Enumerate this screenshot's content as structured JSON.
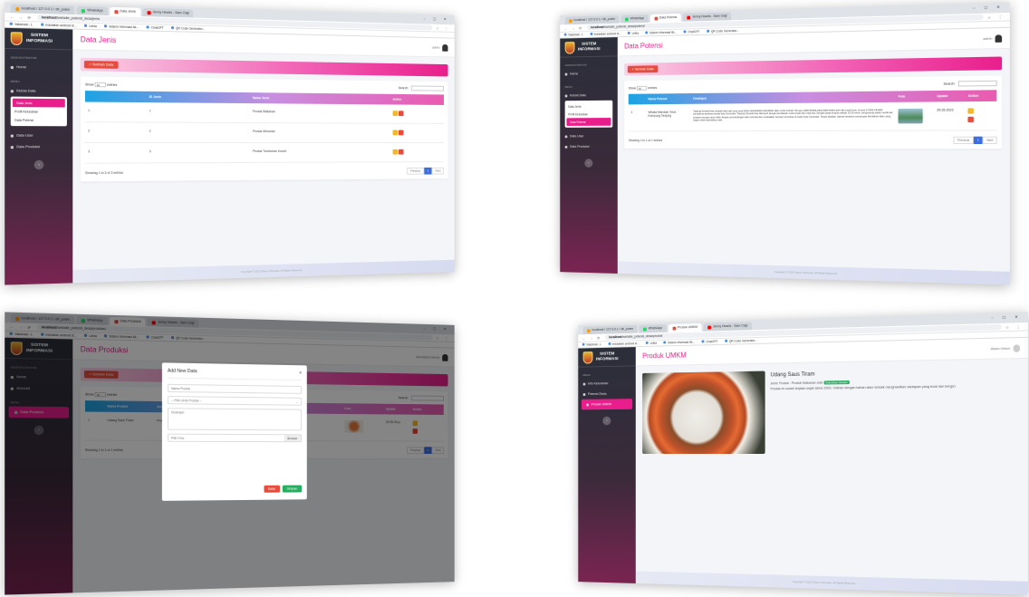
{
  "browser": {
    "tabs_s1": [
      "localhost / 127.0.0.1 / db_poten",
      "WhatsApp",
      "Data Jenis",
      "Jenny Hearts - Sam Claji"
    ],
    "tabs_s2": [
      "localhost / 127.0.0.1 / db_poten",
      "WhatsApp",
      "Data Potensi",
      "Jenny Hearts - Sam Claji"
    ],
    "tabs_s3": [
      "localhost / 127.0.0.1 / db_poten",
      "WhatsApp",
      "Data Produksi",
      "Jenny Hearts - Sam Claji"
    ],
    "tabs_s4": [
      "localhost / 127.0.0.1 / db_poten",
      "WhatsApp",
      "Produk UMKM",
      "Jenny Hearts - Sam Claji"
    ],
    "url_host": "localhost",
    "url_s1": "/website_potensi_desa/jenis",
    "url_s2": "/website_potensi_desa/potensi",
    "url_s3": "/website_potensi_desa/produksi",
    "url_s4": "/website_potensi_desa/produk",
    "bookmarks": [
      "Vaksinasi - L",
      "Indolatian android st...",
      "Lekta",
      "Sistem Informasi Ak...",
      "ChatGPT",
      "QR Code Generator..."
    ]
  },
  "sidebar": {
    "brand_line1": "SISTEM",
    "brand_line2": "INFORMASI",
    "admin_label": "ADMINISTRATOR",
    "menu_label": "MENU",
    "home": "Home",
    "kelola_data": "Kelola Data",
    "sub_jenis": "Data Jenis",
    "sub_profil": "Profil Kelurahan",
    "sub_potensi": "Data Potensi",
    "data_user": "Data User",
    "data_produksi": "Data Produksi",
    "account": "Account",
    "info_kelurahan": "Info Kelurahan",
    "potensi_desa": "Potensi Desa",
    "produk_umkm": "Produk UMKM"
  },
  "s1": {
    "title": "Data Jenis",
    "user": "admin",
    "add_button": "Tambah Data",
    "show": "Show",
    "entries_val": "10",
    "entries": "entries",
    "search": "Search:",
    "headers": [
      "",
      "ID Jenis",
      "Nama Jenis",
      "Action"
    ],
    "rows": [
      [
        "1",
        "1",
        "Produk Makanan"
      ],
      [
        "2",
        "2",
        "Produk Minuman"
      ],
      [
        "3",
        "3",
        "Produk Tumbuhan Kunuh"
      ]
    ],
    "showing": "Showing 1 to 3 of 3 entries",
    "prev": "Previous",
    "page": "1",
    "next": "Next",
    "footer": "Copyright © 2023 Sistem Informasi. All Rights Reserved"
  },
  "s2": {
    "title": "Data Potensi",
    "user": "admin",
    "add_button": "Tambah Data",
    "show": "Show",
    "entries_val": "10",
    "entries": "entries",
    "search": "Search:",
    "headers": [
      "",
      "Nama Potensi",
      "Deskripsi",
      "Foto",
      "Update",
      "Action"
    ],
    "row_no": "1",
    "row_name": "Wisata Mandasi Teluk Kampung Tanjung",
    "row_desc": "Tanjung Senetal bisa menjadi alternatif yang tepat yang menawarkan keindahan alam sudut terbaik. Dengan jarak tempat yang tidak terlalu jauh dari pusat kota, tempat ini bisa menjadi primadona destinasi wisata kota Gorontalo. Tanjung Senetal bisa ditempuh dengan kendaraan roda empat dan roda dua. Dengan jarak tempuh sekitar 15-30 menit, pengunjung dapat menikmati suasana tempat yang indah dengan pemandangan alam terbuka dan merasakan sensasi memukau di sudut Kota Gorontalo. Tanpa disadari, daerah tersebut menyimpan keindahan alam yang begitu indah dipandang mata.",
    "row_date": "29-05-2023",
    "showing": "Showing 1 to 1 of 1 entries",
    "prev": "Previous",
    "page": "1",
    "next": "Next",
    "footer": "Copyright © 2023 Sistem Informasi. All Rights Reserved"
  },
  "s3": {
    "title": "Data Produksi",
    "user": "Siamatiatun Meraiu",
    "add_button": "Tambah Data",
    "show": "Show",
    "entries_val": "10",
    "entries": "entries",
    "search": "Search:",
    "headers": [
      "",
      "Nama Produk",
      "Jenis Produk",
      "",
      "Foto",
      "Update",
      "Action"
    ],
    "row_no": "1",
    "row_name": "Udang Saus Tiram",
    "row_jenis": "Produk Makanan",
    "row_desc": "menghasilkan santapan",
    "row_date": "29-05-2023",
    "showing": "Showing 1 to 1 of 1 entries",
    "prev": "Previous",
    "page": "1",
    "next": "Next",
    "modal_title": "Add New Data",
    "modal_close": "×",
    "ph_nama": "Nama Produk",
    "ph_jenis": "-- Pilih Jenis Produk --",
    "ph_desk": "Deskripsi",
    "ph_foto": "Pilih Foto",
    "browse": "Browse",
    "btn_batal": "Batal",
    "btn_simpan": "Simpan"
  },
  "s4": {
    "title": "Produk UMKM",
    "user": "Akses Umum",
    "product_name": "Udang Saus Tiram",
    "jenis_prefix": "Jenis Produk : Produk Makanan olah",
    "badge": "Kelurahan Heuleh",
    "desc": "Produk ini sudah terjalan sejak tahun 2003. Olahan dengan bahan alam terbaik menghasilkan santapan yang lezat dan bergizi.",
    "footer": "Copyright © 2023 Sistem Informasi. All Rights Reserved"
  },
  "colors": {
    "accent": "#e91e8c",
    "danger": "#e74c3c",
    "warning": "#f1b82d",
    "primary": "#3c6ee0"
  }
}
